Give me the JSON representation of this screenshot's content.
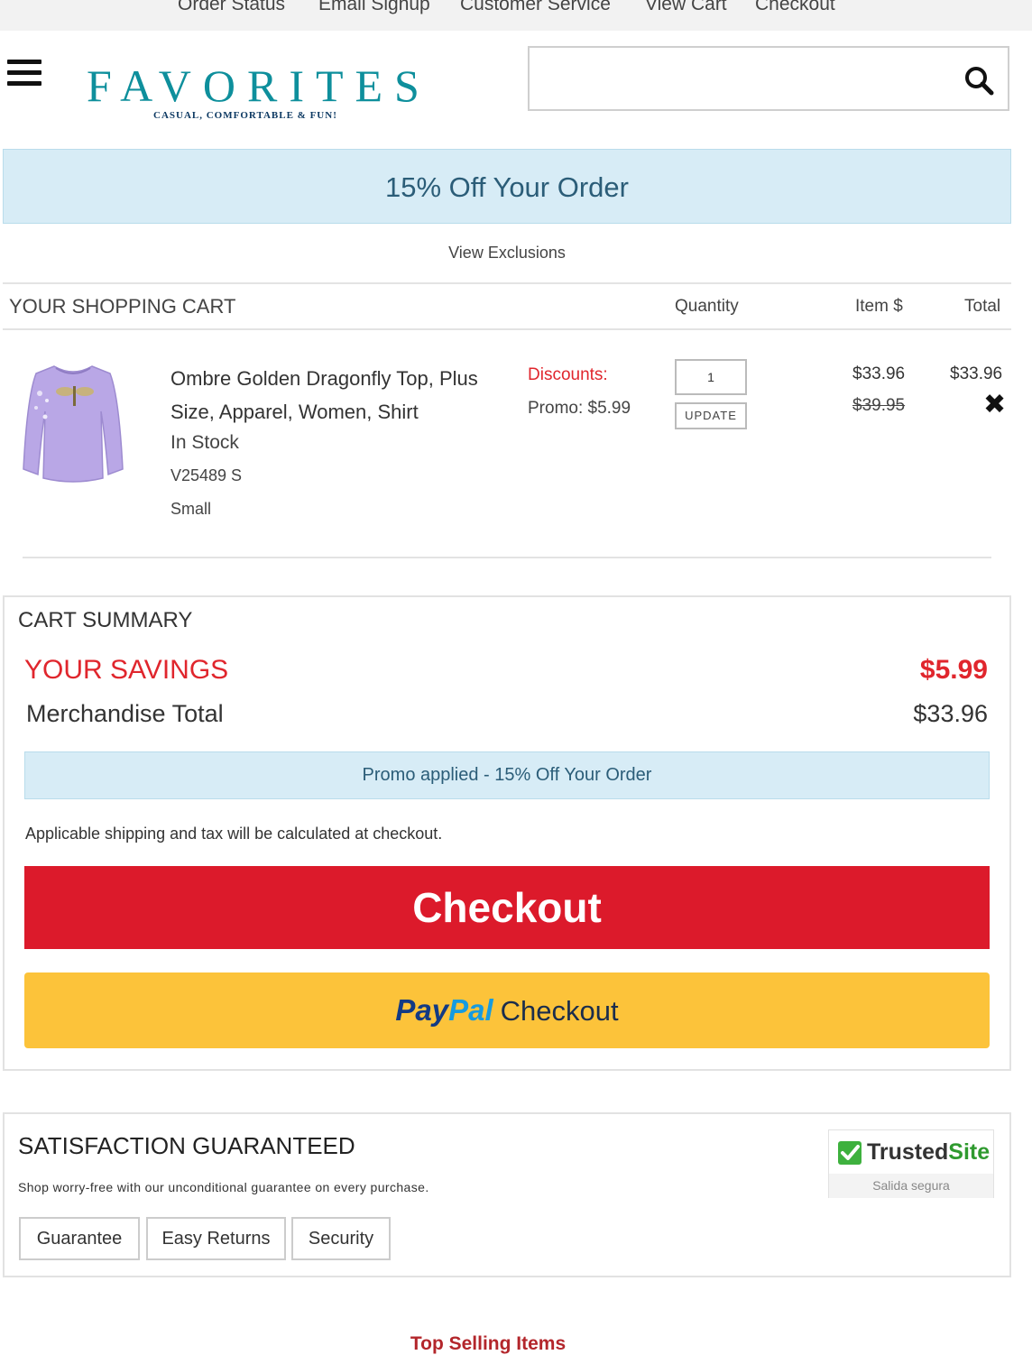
{
  "top_nav": [
    "Order Status",
    "Email Signup",
    "Customer Service",
    "View Cart",
    "Checkout"
  ],
  "header": {
    "logo_text": "FAVORITES",
    "logo_tagline": "CASUAL, COMFORTABLE & FUN!",
    "search_placeholder": "",
    "search_icon": "search-icon",
    "menu_icon": "hamburger-menu-icon"
  },
  "promo_banner": {
    "text": "15% Off Your Order",
    "exclusions_link": "View Exclusions"
  },
  "cart": {
    "title": "YOUR SHOPPING CART",
    "columns": {
      "quantity": "Quantity",
      "item_price": "Item $",
      "total": "Total"
    },
    "items": [
      {
        "name": "Ombre Golden Dragonfly Top, Plus Size, Apparel, Women, Shirt",
        "stock": "In Stock",
        "sku": "V25489 S",
        "size": "Small",
        "discounts_label": "Discounts:",
        "promo": "Promo: $5.99",
        "quantity": "1",
        "update_label": "UPDATE",
        "item_price": "$33.96",
        "original_price": "$39.95",
        "total": "$33.96",
        "remove_icon": "close-icon"
      }
    ]
  },
  "summary": {
    "title": "CART SUMMARY",
    "savings_label": "YOUR SAVINGS",
    "savings_value": "$5.99",
    "merch_label": "Merchandise Total",
    "merch_value": "$33.96",
    "promo_applied": "Promo applied - 15% Off Your Order",
    "shipping_note": "Applicable shipping and tax will be calculated at checkout.",
    "checkout_label": "Checkout",
    "paypal": {
      "pay": "Pay",
      "pal": "Pal",
      "checkout": "Checkout"
    }
  },
  "satisfaction": {
    "title": "SATISFACTION GUARANTEED",
    "text": "Shop worry-free with our unconditional guarantee on every purchase.",
    "tabs": [
      "Guarantee",
      "Easy Returns",
      "Security"
    ],
    "badge": {
      "brand_a": "Trusted",
      "brand_b": "Site",
      "subtitle": "Salida segura"
    }
  },
  "top_selling": "Top Selling Items",
  "colors": {
    "brand_teal": "#0e8f9c",
    "promo_bg": "#d7ecf6",
    "checkout_red": "#dc1a2b",
    "paypal_yellow": "#fcc33a",
    "savings_red": "#e0262d"
  }
}
